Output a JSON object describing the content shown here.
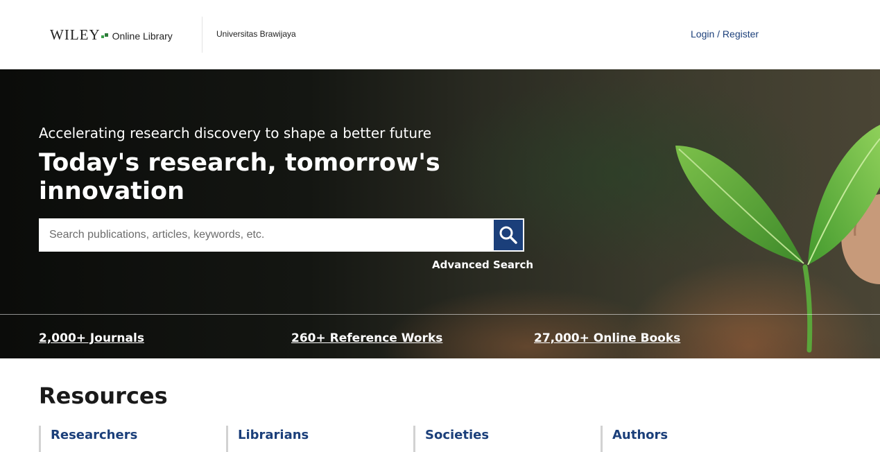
{
  "header": {
    "logo_wiley": "WILEY",
    "logo_online_library": "Online Library",
    "institution": "Universitas Brawijaya",
    "login_link": "Login / Register"
  },
  "hero": {
    "subtitle": "Accelerating research discovery to shape a better future",
    "title": "Today's research, tomorrow's innovation",
    "search": {
      "placeholder": "Search publications, articles, keywords, etc.",
      "button_icon": "search-icon"
    },
    "advanced_search": "Advanced Search",
    "stats": [
      "2,000+ Journals",
      "260+ Reference Works",
      "27,000+ Online Books"
    ]
  },
  "resources": {
    "title": "Resources",
    "items": [
      "Researchers",
      "Librarians",
      "Societies",
      "Authors"
    ]
  },
  "colors": {
    "brand_blue": "#1b3f7a",
    "logo_green": "#3aa04a"
  }
}
